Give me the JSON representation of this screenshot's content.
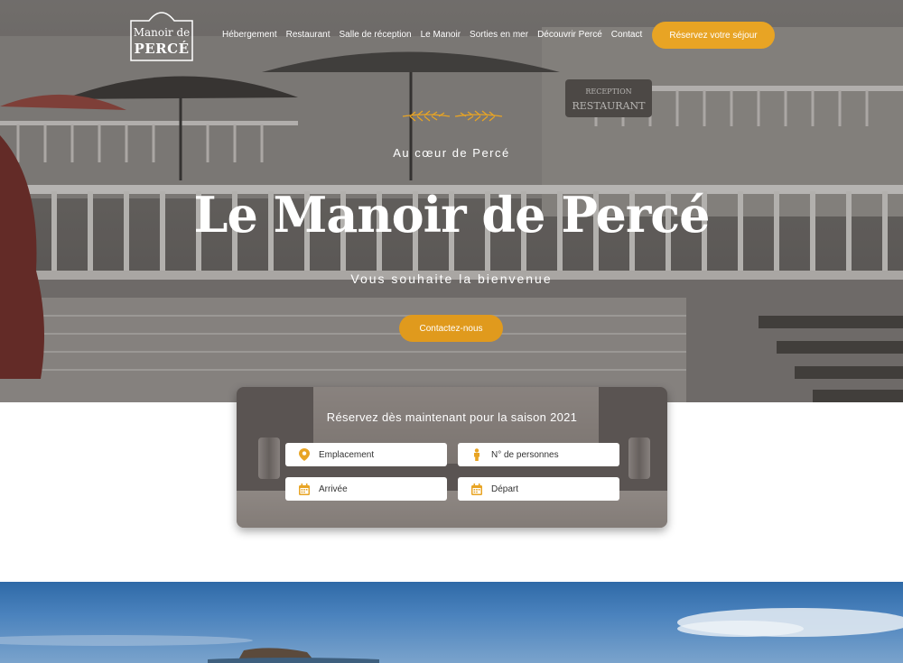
{
  "header": {
    "logo_line1": "Manoir de",
    "logo_line2": "PERCÉ",
    "nav": [
      "Hébergement",
      "Restaurant",
      "Salle de réception",
      "Le Manoir",
      "Sorties en mer",
      "Découvrir Percé",
      "Contact"
    ],
    "cta_label": "Réservez votre séjour"
  },
  "hero": {
    "kicker": "Au cœur de Percé",
    "title": "Le Manoir de Percé",
    "subtitle": "Vous souhaite la bienvenue",
    "cta_label": "Contactez-nous"
  },
  "booking": {
    "heading": "Réservez dès maintenant pour la saison 2021",
    "fields": [
      {
        "placeholder": "Emplacement",
        "icon": "location-pin-icon"
      },
      {
        "placeholder": "N° de personnes",
        "icon": "person-icon"
      },
      {
        "placeholder": "Arrivée",
        "icon": "calendar-icon"
      },
      {
        "placeholder": "Départ",
        "icon": "calendar-icon"
      }
    ]
  },
  "colors": {
    "accent": "#e8a424",
    "hero_text": "#ffffff"
  }
}
